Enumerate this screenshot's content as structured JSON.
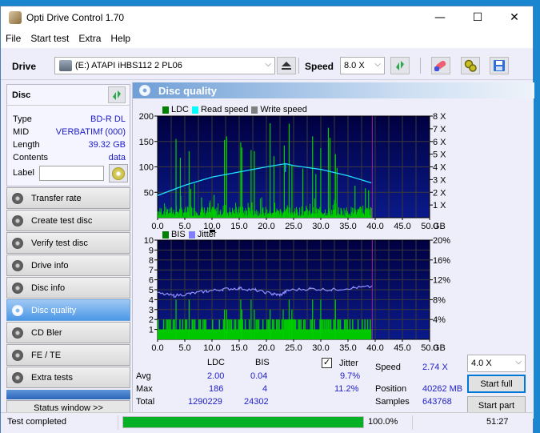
{
  "window": {
    "title": "Opti Drive Control 1.70",
    "controls": {
      "minimize": "—",
      "maximize": "☐",
      "close": "✕"
    }
  },
  "menu": [
    "File",
    "Start test",
    "Extra",
    "Help"
  ],
  "toolbar": {
    "drive_label": "Drive",
    "drive_value": "(E:)  ATAPI iHBS112  2 PL06",
    "speed_label": "Speed",
    "speed_value": "8.0 X",
    "icons": [
      "eject-icon",
      "refresh-icon",
      "eraser-icon",
      "settings-icon",
      "save-icon"
    ]
  },
  "disc": {
    "header": "Disc",
    "rows": [
      {
        "label": "Type",
        "value": "BD-R DL"
      },
      {
        "label": "MID",
        "value": "VERBATIMf (000)"
      },
      {
        "label": "Length",
        "value": "39.32 GB"
      },
      {
        "label": "Contents",
        "value": "data"
      }
    ],
    "label_field": {
      "label": "Label",
      "value": ""
    }
  },
  "nav": [
    {
      "label": "Transfer rate",
      "active": false
    },
    {
      "label": "Create test disc",
      "active": false
    },
    {
      "label": "Verify test disc",
      "active": false
    },
    {
      "label": "Drive info",
      "active": false
    },
    {
      "label": "Disc info",
      "active": false
    },
    {
      "label": "Disc quality",
      "active": true
    },
    {
      "label": "CD Bler",
      "active": false
    },
    {
      "label": "FE / TE",
      "active": false
    },
    {
      "label": "Extra tests",
      "active": false
    }
  ],
  "status_window_btn": "Status window >>",
  "panel": {
    "title": "Disc quality"
  },
  "chart_data": [
    {
      "type": "bar",
      "title": "",
      "legend": [
        {
          "name": "LDC",
          "color": "#008000"
        },
        {
          "name": "Read speed",
          "color": "#00ffff"
        },
        {
          "name": "Write speed",
          "color": "#808080"
        }
      ],
      "legend_position": "top-left",
      "xlabel": "GB",
      "x_ticks": [
        "0.0",
        "5.0",
        "10.0",
        "15.0",
        "20.0",
        "25.0",
        "30.0",
        "35.0",
        "40.0",
        "45.0",
        "50.0"
      ],
      "xlim": [
        0,
        50
      ],
      "y_ticks_left": [
        "50",
        "100",
        "150",
        "200"
      ],
      "ylim_left": [
        0,
        200
      ],
      "y_ticks_right": [
        "1 X",
        "2 X",
        "3 X",
        "4 X",
        "5 X",
        "6 X",
        "7 X",
        "8 X"
      ],
      "ylim_right": [
        0,
        8
      ],
      "grid": true,
      "end_marker_gb": 39.32,
      "ldc_spikes": [
        {
          "x": 3.3,
          "y": 155
        },
        {
          "x": 4.1,
          "y": 118
        },
        {
          "x": 5.7,
          "y": 131
        },
        {
          "x": 6.0,
          "y": 57
        },
        {
          "x": 6.7,
          "y": 67
        },
        {
          "x": 8.0,
          "y": 40
        },
        {
          "x": 10.3,
          "y": 45
        },
        {
          "x": 12.2,
          "y": 153
        },
        {
          "x": 12.6,
          "y": 160
        },
        {
          "x": 15.2,
          "y": 148
        },
        {
          "x": 15.4,
          "y": 138
        },
        {
          "x": 17.1,
          "y": 133
        },
        {
          "x": 17.7,
          "y": 131
        },
        {
          "x": 20.6,
          "y": 186
        },
        {
          "x": 21.3,
          "y": 121
        },
        {
          "x": 23.2,
          "y": 142
        },
        {
          "x": 24.1,
          "y": 185
        },
        {
          "x": 24.6,
          "y": 103
        },
        {
          "x": 26.6,
          "y": 97
        },
        {
          "x": 28.4,
          "y": 160
        },
        {
          "x": 29.0,
          "y": 86
        },
        {
          "x": 29.9,
          "y": 137
        },
        {
          "x": 31.3,
          "y": 177
        },
        {
          "x": 31.6,
          "y": 157
        },
        {
          "x": 32.6,
          "y": 125
        },
        {
          "x": 32.9,
          "y": 98
        },
        {
          "x": 36.2,
          "y": 63
        },
        {
          "x": 38.1,
          "y": 58
        },
        {
          "x": 38.7,
          "y": 54
        }
      ],
      "ldc_baseline": 12,
      "read_speed": [
        {
          "x": 0,
          "y": 1.75
        },
        {
          "x": 5,
          "y": 2.55
        },
        {
          "x": 10,
          "y": 3.2
        },
        {
          "x": 15,
          "y": 3.6
        },
        {
          "x": 20,
          "y": 4.0
        },
        {
          "x": 23.5,
          "y": 4.25
        },
        {
          "x": 25,
          "y": 4.1
        },
        {
          "x": 30,
          "y": 3.8
        },
        {
          "x": 35,
          "y": 3.3
        },
        {
          "x": 39.3,
          "y": 2.74
        }
      ]
    },
    {
      "type": "bar",
      "title": "",
      "legend": [
        {
          "name": "BIS",
          "color": "#008000"
        },
        {
          "name": "Jitter",
          "color": "#8080ff"
        }
      ],
      "legend_position": "top-left",
      "xlabel": "GB",
      "x_ticks": [
        "0.0",
        "5.0",
        "10.0",
        "15.0",
        "20.0",
        "25.0",
        "30.0",
        "35.0",
        "40.0",
        "45.0",
        "50.0"
      ],
      "xlim": [
        0,
        50
      ],
      "y_ticks_left": [
        "1",
        "2",
        "3",
        "4",
        "5",
        "6",
        "7",
        "8",
        "9",
        "10"
      ],
      "ylim_left": [
        0,
        10
      ],
      "y_ticks_right": [
        "4%",
        "8%",
        "12%",
        "16%",
        "20%"
      ],
      "ylim_right": [
        0,
        20
      ],
      "grid": true,
      "end_marker_gb": 39.32,
      "bis_baseline": 1,
      "bis_spikes": [
        {
          "x": 3.3,
          "y": 4
        },
        {
          "x": 5.7,
          "y": 4
        },
        {
          "x": 12.2,
          "y": 3
        },
        {
          "x": 12.6,
          "y": 3
        },
        {
          "x": 15.2,
          "y": 4
        },
        {
          "x": 15.4,
          "y": 3
        },
        {
          "x": 17.1,
          "y": 4
        },
        {
          "x": 17.7,
          "y": 3
        },
        {
          "x": 20.6,
          "y": 3
        },
        {
          "x": 23.0,
          "y": 3
        },
        {
          "x": 24.1,
          "y": 4
        },
        {
          "x": 24.6,
          "y": 3
        },
        {
          "x": 28.4,
          "y": 4
        },
        {
          "x": 29.9,
          "y": 4
        },
        {
          "x": 32.6,
          "y": 4
        }
      ],
      "jitter": [
        {
          "x": 0,
          "y": 9.3
        },
        {
          "x": 3,
          "y": 8.8
        },
        {
          "x": 6,
          "y": 9.2
        },
        {
          "x": 9,
          "y": 9.7
        },
        {
          "x": 12,
          "y": 10.1
        },
        {
          "x": 15,
          "y": 10.3
        },
        {
          "x": 18,
          "y": 9.9
        },
        {
          "x": 21,
          "y": 9.2
        },
        {
          "x": 22.5,
          "y": 8.9
        },
        {
          "x": 24,
          "y": 9.9
        },
        {
          "x": 28,
          "y": 10.2
        },
        {
          "x": 32,
          "y": 10.0
        },
        {
          "x": 36,
          "y": 10.4
        },
        {
          "x": 39.3,
          "y": 10.6
        }
      ]
    }
  ],
  "stats": {
    "col_ldc": "LDC",
    "col_bis": "BIS",
    "jitter_checked": true,
    "jitter_label": "Jitter",
    "rows": [
      {
        "label": "Avg",
        "ldc": "2.00",
        "bis": "0.04",
        "jitter": "9.7%"
      },
      {
        "label": "Max",
        "ldc": "186",
        "bis": "4",
        "jitter": "11.2%"
      },
      {
        "label": "Total",
        "ldc": "1290229",
        "bis": "24302",
        "jitter": ""
      }
    ],
    "speed_label": "Speed",
    "speed_value": "2.74 X",
    "position_label": "Position",
    "position_value": "40262 MB",
    "samples_label": "Samples",
    "samples_value": "643768",
    "test_speed": "4.0 X",
    "start_full": "Start full",
    "start_part": "Start part"
  },
  "statusbar": {
    "text": "Test completed",
    "progress_percent": 100,
    "progress_label": "100.0%",
    "elapsed": "51:27"
  }
}
